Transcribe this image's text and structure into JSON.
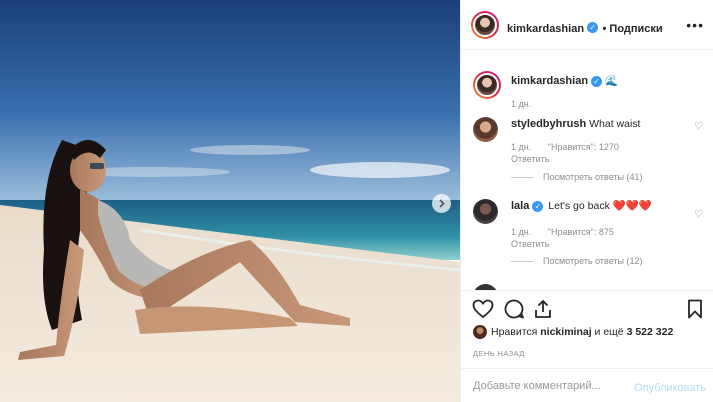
{
  "post": {
    "author": "kimkardashian",
    "follow_label": "• Подписки",
    "more_label": "•••",
    "caption_emoji": "🌊",
    "caption_time": "1 дн."
  },
  "comments": [
    {
      "user": "styledbyhrush",
      "text": "What waist",
      "time": "1 дн.",
      "likes": "\"Нравится\": 1270",
      "reply": "Ответить",
      "view_replies": "Посмотреть ответы (41)"
    },
    {
      "user": "lala",
      "text": "Let's go back ❤️❤️❤️",
      "time": "1 дн.",
      "likes": "\"Нравится\": 875",
      "reply": "Ответить",
      "view_replies": "Посмотреть ответы (12)"
    }
  ],
  "likes_line": {
    "prefix": "Нравится",
    "user": "nickiminaj",
    "suffix": "и ещё",
    "count": "3 522 322"
  },
  "date_label": "ДЕНЬ НАЗАД",
  "composer": {
    "placeholder": "Добавьте комментарий...",
    "publish_label": "Опубликовать"
  },
  "colors": {
    "verified": "#3897f0",
    "publish_disabled": "#b2dffc",
    "sky_top": "#1e4b8a",
    "sea": "#2c7f9c"
  }
}
